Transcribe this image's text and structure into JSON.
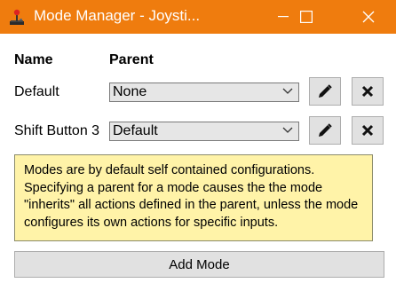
{
  "window": {
    "title": "Mode Manager - Joysti...",
    "title_bar_color": "#ef7c0e"
  },
  "columns": {
    "name": "Name",
    "parent": "Parent"
  },
  "modes": [
    {
      "name": "Default",
      "parent": "None"
    },
    {
      "name": "Shift Button 3",
      "parent": "Default"
    }
  ],
  "info": {
    "text": "Modes are by default self contained configurations. Specifying a parent for a mode causes the the mode \"inherits\" all actions defined in the parent, unless the mode configures its own actions for specific inputs."
  },
  "add_button": {
    "label": "Add Mode"
  },
  "icons": {
    "app": "joystick-icon",
    "edit": "pencil-icon",
    "delete": "close-x-icon",
    "dropdown": "chevron-down-icon"
  },
  "colors": {
    "info_background": "#fff3a8",
    "button_face": "#e1e1e1"
  }
}
